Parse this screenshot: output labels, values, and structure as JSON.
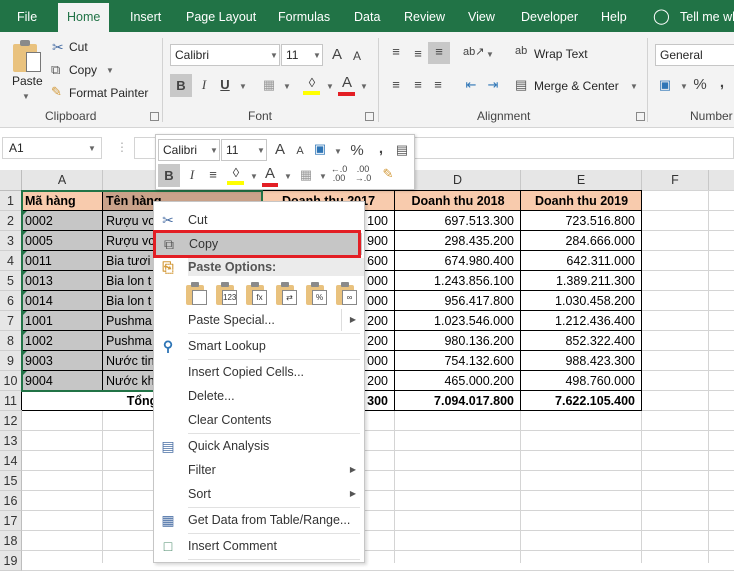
{
  "tabs": [
    "File",
    "Home",
    "Insert",
    "Page Layout",
    "Formulas",
    "Data",
    "Review",
    "View",
    "Developer",
    "Help"
  ],
  "active_tab": "Home",
  "tell_me": "Tell me wh",
  "clipboard": {
    "paste": "Paste",
    "cut": "Cut",
    "copy": "Copy",
    "format_painter": "Format Painter",
    "label": "Clipboard"
  },
  "font": {
    "name": "Calibri",
    "size": "11",
    "label": "Font",
    "bold": "B",
    "italic": "I",
    "underline": "U",
    "grow": "A",
    "shrink": "A",
    "font_color": "A"
  },
  "alignment": {
    "wrap_text": "Wrap Text",
    "merge_center": "Merge & Center",
    "label": "Alignment"
  },
  "number": {
    "format": "General",
    "percent": "%",
    "comma": ",",
    "label": "Number"
  },
  "name_box": "A1",
  "mini_toolbar": {
    "font": "Calibri",
    "size": "11",
    "percent": "%",
    "comma": ",",
    "bold": "B",
    "italic": "I",
    "font_color": "A",
    "inc_dec": "←.0\n.00",
    "dec_dec": ".00\n→.0"
  },
  "columns": [
    "A",
    "B",
    "C",
    "D",
    "E",
    "F"
  ],
  "rows": [
    "1",
    "2",
    "3",
    "4",
    "5",
    "6",
    "7",
    "8",
    "9",
    "10",
    "11",
    "12",
    "13",
    "14",
    "15",
    "16",
    "17",
    "18",
    "19"
  ],
  "sheet": {
    "headers": [
      "Mã hàng",
      "Tên hàng",
      "Doanh thu 2017",
      "Doanh thu 2018",
      "Doanh thu 2019"
    ],
    "data": [
      {
        "code": "0002",
        "name": "Rượu vc",
        "y2017": "100",
        "y2018": "697.513.300",
        "y2019": "723.516.800"
      },
      {
        "code": "0005",
        "name": "Rượu vc",
        "y2017": "900",
        "y2018": "298.435.200",
        "y2019": "284.666.000"
      },
      {
        "code": "0011",
        "name": "Bia tươi",
        "y2017": "600",
        "y2018": "674.980.400",
        "y2019": "642.311.000"
      },
      {
        "code": "0013",
        "name": "Bia lon t",
        "y2017": "000",
        "y2018": "1.243.856.100",
        "y2019": "1.389.211.300"
      },
      {
        "code": "0014",
        "name": "Bia lon t",
        "y2017": "000",
        "y2018": "956.417.800",
        "y2019": "1.030.458.200"
      },
      {
        "code": "1001",
        "name": "Pushma",
        "y2017": "200",
        "y2018": "1.023.546.000",
        "y2019": "1.212.436.400"
      },
      {
        "code": "1002",
        "name": "Pushma",
        "y2017": "200",
        "y2018": "980.136.200",
        "y2019": "852.322.400"
      },
      {
        "code": "9003",
        "name": "Nước tin",
        "y2017": "000",
        "y2018": "754.132.600",
        "y2019": "988.423.300"
      },
      {
        "code": "9004",
        "name": "Nước kh",
        "y2017": "200",
        "y2018": "465.000.200",
        "y2019": "498.760.000"
      }
    ],
    "total": {
      "label": "Tổng",
      "y2017": "300",
      "y2018": "7.094.017.800",
      "y2019": "7.622.105.400"
    }
  },
  "context_menu": {
    "cut": "Cut",
    "copy": "Copy",
    "paste_options": "Paste Options:",
    "paste_special": "Paste Special...",
    "smart_lookup": "Smart Lookup",
    "insert_copied": "Insert Copied Cells...",
    "delete": "Delete...",
    "clear_contents": "Clear Contents",
    "quick_analysis": "Quick Analysis",
    "filter": "Filter",
    "sort": "Sort",
    "get_data": "Get Data from Table/Range...",
    "insert_comment": "Insert Comment",
    "paste_icons": [
      "paste-icon",
      "paste-values-icon",
      "paste-formulas-icon",
      "paste-transpose-icon",
      "paste-formatting-icon",
      "paste-link-icon"
    ]
  },
  "colors": {
    "excel_green": "#217346",
    "header_fill": "#f8cbad",
    "selection_gray": "#c6c6c6",
    "highlight_red": "#e31e24"
  }
}
